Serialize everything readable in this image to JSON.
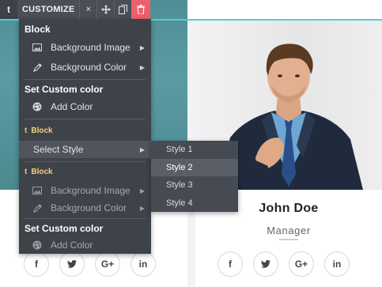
{
  "toolbar": {
    "handle": "t",
    "title": "CUSTOMIZE",
    "close_icon": "×",
    "move_icon": "move-icon",
    "duplicate_icon": "duplicate-icon",
    "delete_icon": "trash-icon"
  },
  "menu": {
    "section1_heading": "Block",
    "bg_image_label": "Background Image",
    "bg_color_label": "Background Color",
    "section2_heading": "Set Custom color",
    "add_color_label": "Add Color",
    "sub_block_label": "Block",
    "select_style_label": "Select Style",
    "sub_block2_label": "Block",
    "bg_image2_label": "Background Image",
    "bg_color2_label": "Background Color",
    "section3_heading": "Set Custom color",
    "add_color2_label": "Add Color"
  },
  "submenu": {
    "items": [
      "Style 1",
      "Style 2",
      "Style 3",
      "Style 4"
    ],
    "selected": "Style 2"
  },
  "profile": {
    "name": "John Doe",
    "role": "Manager"
  },
  "socials": [
    "f",
    "🐦",
    "G+",
    "in"
  ],
  "colors": {
    "toolbar_bg": "#4a4f57",
    "menu_bg": "#3e4249",
    "delete_bg": "#ef5f6b",
    "accent_teal": "#5bc9d6",
    "sub_label": "#f4cf7d"
  }
}
